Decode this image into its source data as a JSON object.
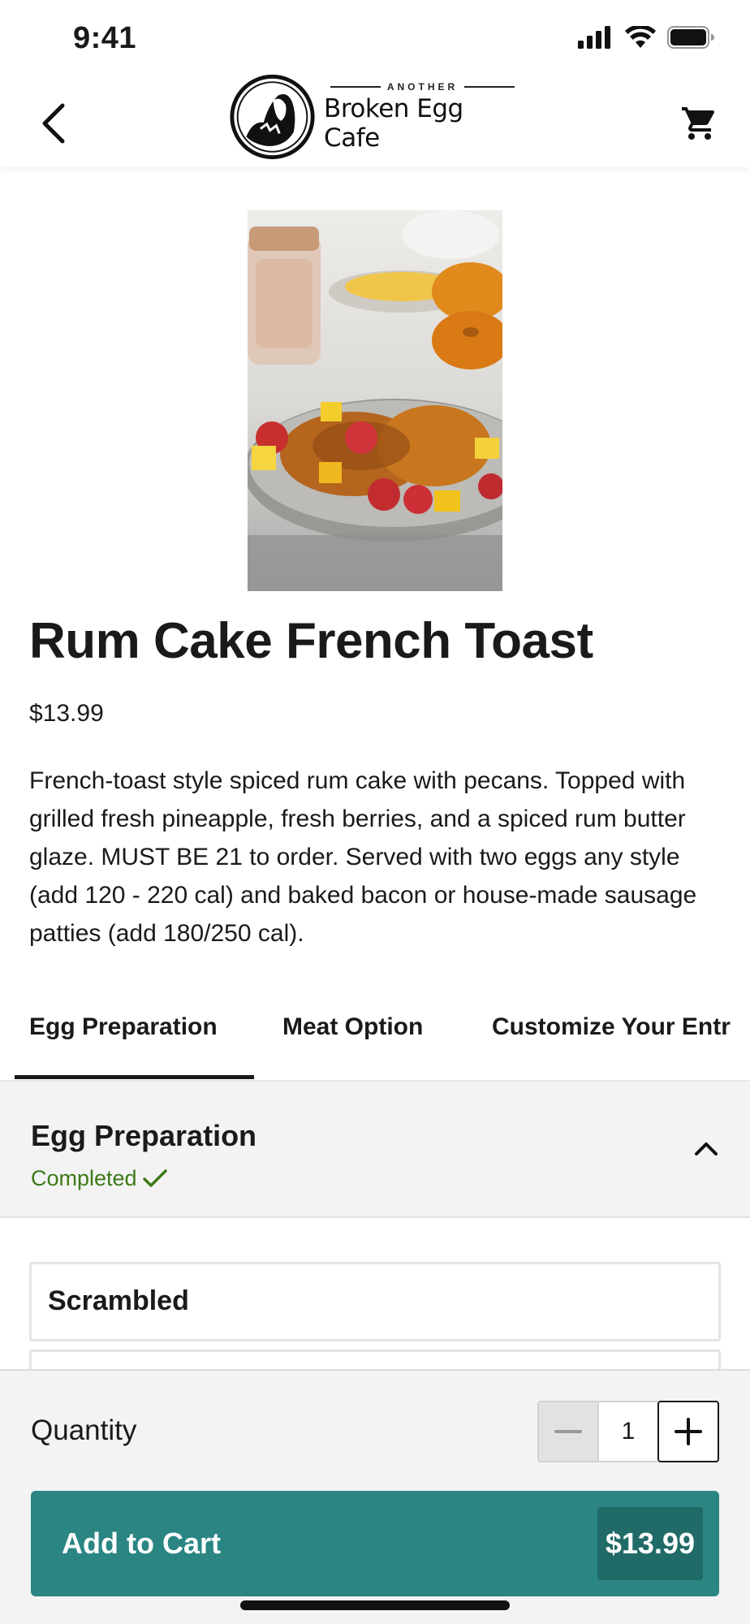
{
  "status_bar": {
    "time": "9:41",
    "icons": [
      "signal-icon",
      "wifi-icon",
      "battery-icon"
    ]
  },
  "header": {
    "back_icon": "chevron-left-icon",
    "logo": {
      "small_text": "ANOTHER",
      "big_text": "Broken Egg Cafe"
    },
    "cart_icon": "cart-icon"
  },
  "product": {
    "image": "food-photo-french-toast",
    "title": "Rum Cake French Toast",
    "price": "$13.99",
    "description": "French-toast style spiced rum cake with pecans. Topped with grilled fresh pineapple, fresh berries, and a spiced rum butter glaze. MUST BE 21 to order. Served with two eggs any style (add 120 - 220 cal) and baked bacon or house-made sausage patties (add 180/250 cal)."
  },
  "tabs": [
    {
      "label": "Egg Preparation",
      "active": true
    },
    {
      "label": "Meat Option",
      "active": false
    },
    {
      "label": "Customize Your Entr",
      "active": false
    }
  ],
  "section": {
    "title": "Egg Preparation",
    "status": "Completed",
    "status_color": "#3d7a17",
    "collapse_icon": "chevron-up-icon"
  },
  "options": [
    {
      "label": "Scrambled"
    },
    {
      "label": ""
    }
  ],
  "bottom_bar": {
    "quantity_label": "Quantity",
    "quantity_value": "1",
    "add_to_cart_label": "Add to Cart",
    "total_price": "$13.99",
    "accent_color": "#2a8583"
  }
}
